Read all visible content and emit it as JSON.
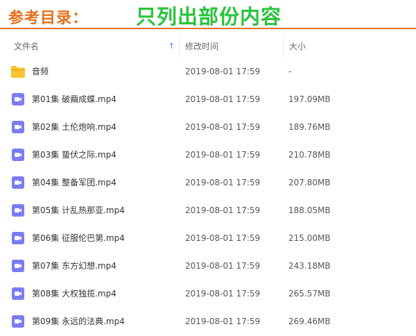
{
  "banner": {
    "title": "参考目录：",
    "note": "只列出部份内容",
    "colors": {
      "title": "#e2701e",
      "note": "#27c43a"
    }
  },
  "columns": {
    "name": "文件名",
    "modified": "修改时间",
    "size": "大小",
    "sort_icon": "sort-up-arrow-icon"
  },
  "files": [
    {
      "icon": "folder-icon",
      "name": "音频",
      "modified": "2019-08-01 17:59",
      "size": "-"
    },
    {
      "icon": "video-file-icon",
      "name": "第01集 破繭成蝶.mp4",
      "modified": "2019-08-01 17:59",
      "size": "197.09MB"
    },
    {
      "icon": "video-file-icon",
      "name": "第02集 土伦炮响.mp4",
      "modified": "2019-08-01 17:59",
      "size": "189.76MB"
    },
    {
      "icon": "video-file-icon",
      "name": "第03集 蛰伏之际.mp4",
      "modified": "2019-08-01 17:59",
      "size": "210.78MB"
    },
    {
      "icon": "video-file-icon",
      "name": "第04集 整备军团.mp4",
      "modified": "2019-08-01 17:59",
      "size": "207.80MB"
    },
    {
      "icon": "video-file-icon",
      "name": "第05集 计乱热那亚.mp4",
      "modified": "2019-08-01 17:59",
      "size": "188.05MB"
    },
    {
      "icon": "video-file-icon",
      "name": "第06集 征服伦巴第.mp4",
      "modified": "2019-08-01 17:59",
      "size": "215.00MB"
    },
    {
      "icon": "video-file-icon",
      "name": "第07集 东方幻想.mp4",
      "modified": "2019-08-01 17:59",
      "size": "243.18MB"
    },
    {
      "icon": "video-file-icon",
      "name": "第08集 大权独揽.mp4",
      "modified": "2019-08-01 17:59",
      "size": "265.57MB"
    },
    {
      "icon": "video-file-icon",
      "name": "第09集 永远的法典.mp4",
      "modified": "2019-08-01 17:59",
      "size": "269.46MB"
    }
  ],
  "icon_colors": {
    "folder": "#f8c42f",
    "video": "#7b7cf2"
  }
}
